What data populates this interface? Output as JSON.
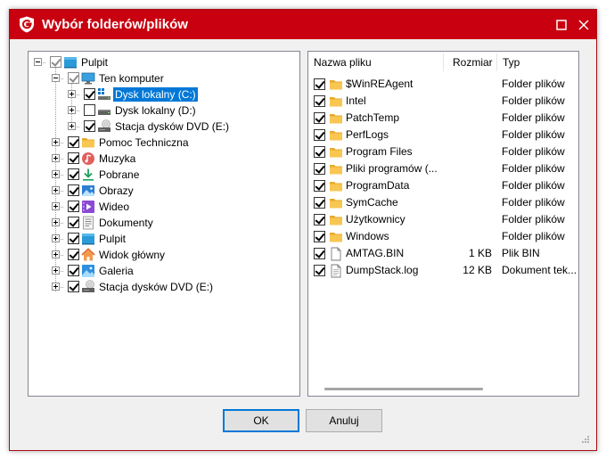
{
  "window": {
    "title": "Wybór folderów/plików"
  },
  "tree": [
    {
      "label": "Pulpit",
      "icon": "desktop-icon",
      "indent": 0,
      "expander": "minus",
      "checked": true,
      "gray": true,
      "selected": false
    },
    {
      "label": "Ten komputer",
      "icon": "computer-icon",
      "indent": 1,
      "expander": "minus",
      "checked": true,
      "gray": true,
      "selected": false
    },
    {
      "label": "Dysk lokalny (C:)",
      "icon": "windows-drive-icon",
      "indent": 2,
      "expander": "plus",
      "checked": true,
      "gray": false,
      "selected": true
    },
    {
      "label": "Dysk lokalny (D:)",
      "icon": "drive-icon",
      "indent": 2,
      "expander": "plus",
      "checked": false,
      "gray": false,
      "selected": false
    },
    {
      "label": "Stacja dysków DVD (E:)",
      "icon": "dvd-drive-icon",
      "indent": 2,
      "expander": "plus",
      "checked": true,
      "gray": false,
      "selected": false
    },
    {
      "label": "Pomoc Techniczna",
      "icon": "folder-icon",
      "indent": 1,
      "expander": "plus",
      "checked": true,
      "gray": false,
      "selected": false
    },
    {
      "label": "Muzyka",
      "icon": "music-icon",
      "indent": 1,
      "expander": "plus",
      "checked": true,
      "gray": false,
      "selected": false
    },
    {
      "label": "Pobrane",
      "icon": "download-icon",
      "indent": 1,
      "expander": "plus",
      "checked": true,
      "gray": false,
      "selected": false
    },
    {
      "label": "Obrazy",
      "icon": "pictures-icon",
      "indent": 1,
      "expander": "plus",
      "checked": true,
      "gray": false,
      "selected": false
    },
    {
      "label": "Wideo",
      "icon": "video-icon",
      "indent": 1,
      "expander": "plus",
      "checked": true,
      "gray": false,
      "selected": false
    },
    {
      "label": "Dokumenty",
      "icon": "documents-icon",
      "indent": 1,
      "expander": "plus",
      "checked": true,
      "gray": false,
      "selected": false
    },
    {
      "label": "Pulpit",
      "icon": "desktop-icon",
      "indent": 1,
      "expander": "plus",
      "checked": true,
      "gray": false,
      "selected": false
    },
    {
      "label": "Widok główny",
      "icon": "home-icon",
      "indent": 1,
      "expander": "plus",
      "checked": true,
      "gray": false,
      "selected": false
    },
    {
      "label": "Galeria",
      "icon": "gallery-icon",
      "indent": 1,
      "expander": "plus",
      "checked": true,
      "gray": false,
      "selected": false
    },
    {
      "label": "Stacja dysków DVD (E:)",
      "icon": "dvd-drive-icon",
      "indent": 1,
      "expander": "plus",
      "checked": true,
      "gray": false,
      "selected": false
    }
  ],
  "file_list": {
    "columns": [
      "Nazwa pliku",
      "Rozmiar",
      "Typ"
    ],
    "rows": [
      {
        "name": "$WinREAgent",
        "size": "",
        "type": "Folder plików",
        "icon": "folder-icon",
        "checked": true
      },
      {
        "name": "Intel",
        "size": "",
        "type": "Folder plików",
        "icon": "folder-icon",
        "checked": true
      },
      {
        "name": "PatchTemp",
        "size": "",
        "type": "Folder plików",
        "icon": "folder-icon",
        "checked": true
      },
      {
        "name": "PerfLogs",
        "size": "",
        "type": "Folder plików",
        "icon": "folder-icon",
        "checked": true
      },
      {
        "name": "Program Files",
        "size": "",
        "type": "Folder plików",
        "icon": "folder-icon",
        "checked": true
      },
      {
        "name": "Pliki programów (...",
        "size": "",
        "type": "Folder plików",
        "icon": "folder-icon",
        "checked": true
      },
      {
        "name": "ProgramData",
        "size": "",
        "type": "Folder plików",
        "icon": "folder-icon",
        "checked": true
      },
      {
        "name": "SymCache",
        "size": "",
        "type": "Folder plików",
        "icon": "folder-icon",
        "checked": true
      },
      {
        "name": "Użytkownicy",
        "size": "",
        "type": "Folder plików",
        "icon": "folder-icon",
        "checked": true
      },
      {
        "name": "Windows",
        "size": "",
        "type": "Folder plików",
        "icon": "folder-icon",
        "checked": true
      },
      {
        "name": "AMTAG.BIN",
        "size": "1 KB",
        "type": "Plik BIN",
        "icon": "file-icon",
        "checked": true
      },
      {
        "name": "DumpStack.log",
        "size": "12 KB",
        "type": "Dokument tek...",
        "icon": "text-file-icon",
        "checked": true
      }
    ]
  },
  "buttons": {
    "ok": "OK",
    "cancel": "Anuluj"
  },
  "colors": {
    "titlebar": "#c8000f",
    "selection": "#0078d7",
    "folder": "#f8c651"
  }
}
